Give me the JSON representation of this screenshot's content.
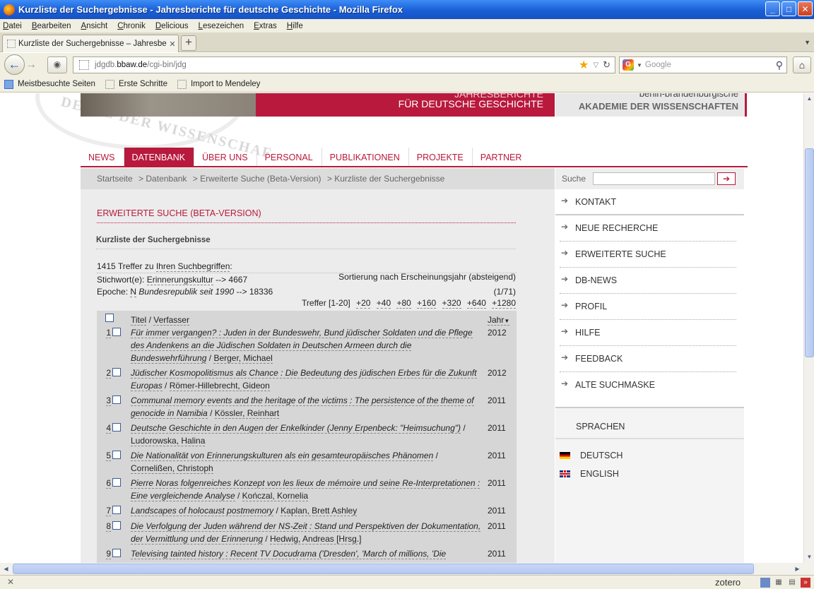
{
  "window": {
    "title": "Kurzliste der Suchergebnisse - Jahresberichte für deutsche Geschichte - Mozilla Firefox",
    "buttons": {
      "minimize": "_",
      "maximize": "□",
      "close": "✕"
    }
  },
  "menubar": [
    "Datei",
    "Bearbeiten",
    "Ansicht",
    "Chronik",
    "Delicious",
    "Lesezeichen",
    "Extras",
    "Hilfe"
  ],
  "tab": {
    "title": "Kurzliste der Suchergebnisse – Jahresbericht...",
    "close": "✕",
    "new": "+"
  },
  "navbar": {
    "url_host": "jdgdb.bbaw.de",
    "url_path": "/cgi-bin/jdg",
    "url_prefix": "jdgdb.",
    "url_domain": "bbaw.de",
    "search_placeholder": "Google"
  },
  "bookmarks": [
    "Meistbesuchte Seiten",
    "Erste Schritte",
    "Import to Mendeley"
  ],
  "banner": {
    "line1": "JAHRESBERICHTE",
    "line2": "FÜR DEUTSCHE GESCHICHTE",
    "acad_line1": "berlin-brandenburgische",
    "acad_line2": "AKADEMIE DER WISSENSCHAFTEN",
    "seal_text": "DEMIE DER WISSENSCHAF"
  },
  "mainnav": [
    {
      "label": "NEWS",
      "active": false
    },
    {
      "label": "DATENBANK",
      "active": true
    },
    {
      "label": "ÜBER UNS",
      "active": false
    },
    {
      "label": "PERSONAL",
      "active": false
    },
    {
      "label": "PUBLIKATIONEN",
      "active": false
    },
    {
      "label": "PROJEKTE",
      "active": false
    },
    {
      "label": "PARTNER",
      "active": false
    }
  ],
  "breadcrumb": [
    "Startseite",
    "> Datenbank",
    "> Erweiterte Suche (Beta-Version)",
    "> Kurzliste der Suchergebnisse"
  ],
  "content": {
    "section_title": "ERWEITERTE SUCHE (BETA-VERSION)",
    "subtitle": "Kurzliste der Suchergebnisse",
    "hits_prefix": "1415 Treffer zu ",
    "hits_link": "Ihren Suchbegriffen",
    "hits_suffix": ":",
    "keyword_label": "Stichwort(e): ",
    "keyword_value": "Erinnerungskultur",
    "keyword_count": " --> 4667",
    "epoch_label": "Epoche: ",
    "epoch_code": "N",
    "epoch_value": "Bundesrepublik seit 1990",
    "epoch_count": " --> 18336",
    "sort_text": "Sortierung nach Erscheinungsjahr (absteigend)",
    "position": "(1/71)",
    "pager_label": "Treffer [1-20]",
    "pager_links": [
      "+20",
      "+40",
      "+80",
      "+160",
      "+320",
      "+640",
      "+1280"
    ]
  },
  "results": {
    "col_title": "Titel",
    "col_sep": " / ",
    "col_author": "Verfasser",
    "col_year": "Jahr",
    "rows": [
      {
        "num": "1",
        "title": "Für immer vergangen? : Juden in der Bundeswehr, Bund jüdischer Soldaten und die Pflege des Andenkens an die Jüdischen Soldaten in Deutschen Armeen durch die Bundeswehrführung",
        "author": "Berger, Michael",
        "year": "2012"
      },
      {
        "num": "2",
        "title": "Jüdischer Kosmopolitismus als Chance : Die Bedeutung des jüdischen Erbes für die Zukunft Europas",
        "author": "Römer-Hillebrecht, Gideon",
        "year": "2012"
      },
      {
        "num": "3",
        "title": "Communal memory events and the heritage of the victims : The persistence of the theme of genocide in Namibia",
        "author": "Kössler, Reinhart",
        "year": "2011"
      },
      {
        "num": "4",
        "title": "Deutsche Geschichte in den Augen der Enkelkinder (Jenny Erpenbeck: \"Heimsuchung\")",
        "author": "Ludorowska, Halina",
        "year": "2011"
      },
      {
        "num": "5",
        "title": "Die Nationalität von Erinnerungskulturen als ein gesamteuropäisches Phänomen",
        "author": "Cornelißen, Christoph",
        "year": "2011"
      },
      {
        "num": "6",
        "title": "Pierre Noras folgenreiches Konzept von les lieux de mémoire und seine Re-Interpretationen : Eine vergleichende Analyse",
        "author": "Kończal, Kornelia",
        "year": "2011"
      },
      {
        "num": "7",
        "title": "Landscapes of holocaust postmemory",
        "author": "Kaplan, Brett Ashley",
        "year": "2011"
      },
      {
        "num": "8",
        "title": "Die Verfolgung der Juden während der NS-Zeit : Stand und Perspektiven der Dokumentation, der Vermittlung und der Erinnerung",
        "author": "Hedwig, Andreas [Hrsg.]",
        "year": "2011"
      },
      {
        "num": "9",
        "title": "Televising tainted history : Recent TV Docudrama ('Dresden', 'March of millions, 'Die",
        "author": "",
        "year": "2011"
      }
    ]
  },
  "sidebar": {
    "search_label": "Suche",
    "search_go": "➔",
    "links": [
      "KONTAKT",
      "NEUE RECHERCHE",
      "ERWEITERTE SUCHE",
      "DB-NEWS",
      "PROFIL",
      "HILFE",
      "FEEDBACK",
      "ALTE SUCHMASKE"
    ],
    "languages_title": "SPRACHEN",
    "languages": [
      "DEUTSCH",
      "ENGLISH"
    ]
  },
  "status": {
    "close": "✕",
    "zotero": "zotero"
  }
}
